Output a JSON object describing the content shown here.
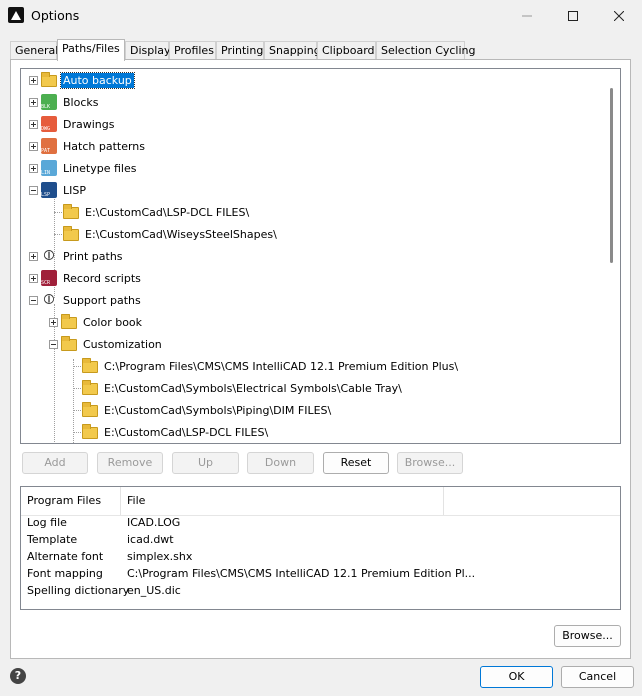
{
  "window": {
    "title": "Options"
  },
  "tabs": [
    "General",
    "Paths/Files",
    "Display",
    "Profiles",
    "Printing",
    "Snapping",
    "Clipboard",
    "Selection Cycling"
  ],
  "active_tab": "Paths/Files",
  "tree": {
    "items": [
      {
        "label": "Auto backup",
        "selected": true
      },
      {
        "label": "Blocks",
        "icon_text": "BLK"
      },
      {
        "label": "Drawings",
        "icon_text": "DWG"
      },
      {
        "label": "Hatch patterns",
        "icon_text": "PAT"
      },
      {
        "label": "Linetype files",
        "icon_text": "LIN"
      },
      {
        "label": "LISP",
        "icon_text": "LSP"
      },
      {
        "label": "E:\\CustomCad\\LSP-DCL FILES\\"
      },
      {
        "label": "E:\\CustomCad\\WiseysSteelShapes\\"
      },
      {
        "label": "Print paths"
      },
      {
        "label": "Record scripts",
        "icon_text": "SCR"
      },
      {
        "label": "Support paths"
      },
      {
        "label": "Color book"
      },
      {
        "label": "Customization"
      },
      {
        "label": "C:\\Program Files\\CMS\\CMS IntelliCAD 12.1 Premium Edition Plus\\"
      },
      {
        "label": "E:\\CustomCad\\Symbols\\Electrical Symbols\\Cable Tray\\"
      },
      {
        "label": "E:\\CustomCad\\Symbols\\Piping\\DIM FILES\\"
      },
      {
        "label": "E:\\CustomCad\\LSP-DCL FILES\\"
      }
    ]
  },
  "buttons": {
    "add": "Add",
    "remove": "Remove",
    "up": "Up",
    "down": "Down",
    "reset": "Reset",
    "browse_tree": "Browse...",
    "browse": "Browse...",
    "ok": "OK",
    "cancel": "Cancel"
  },
  "program_files": {
    "headers": [
      "Program Files",
      "File"
    ],
    "rows": [
      [
        "Log file",
        "ICAD.LOG"
      ],
      [
        "Template",
        "icad.dwt"
      ],
      [
        "Alternate font",
        "simplex.shx"
      ],
      [
        "Font mapping",
        "C:\\Program Files\\CMS\\CMS IntelliCAD 12.1 Premium Edition Pl..."
      ],
      [
        "Spelling dictionary",
        "en_US.dic"
      ]
    ]
  },
  "colors": {
    "selection": "#0078d7",
    "blocks_icon": "#4caf50",
    "drawings_icon": "#e65c3c",
    "hatch_icon": "#e07040",
    "linetype_icon": "#5aa8d8",
    "lisp_icon": "#1f4e8c",
    "scripts_icon": "#a0203a"
  }
}
